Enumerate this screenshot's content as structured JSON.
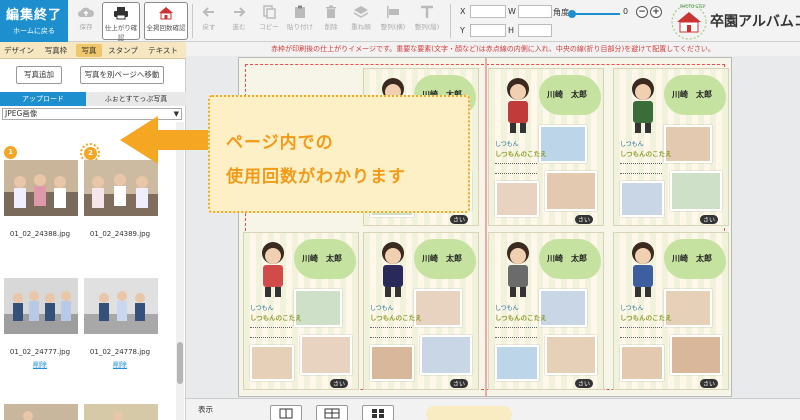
{
  "toolbar": {
    "finish_label": "編集終了",
    "finish_sub": "ホームに戻る",
    "save": "保存",
    "finish_check": "仕上がり確認",
    "usage_check": "全掲回数確認",
    "undo": "戻す",
    "redo": "進む",
    "copy": "コピー",
    "paste": "貼り付け",
    "delete": "削除",
    "layer": "重ね順",
    "align_h": "整列(横)",
    "align_v": "整列(縦)",
    "x_label": "X",
    "y_label": "Y",
    "w_label": "W",
    "h_label": "H",
    "angle_label": "角度",
    "angle_value": "0",
    "zoom_out": "−",
    "zoom_in": "+",
    "logo_text": "卒園アルバムコ",
    "logo_small": "PHOTO STEP"
  },
  "left": {
    "tabs": [
      "デザイン",
      "写真枠",
      "写真",
      "スタンプ",
      "テキスト"
    ],
    "active_tab": "写真",
    "add_photo": "写真追加",
    "move_page": "写真を別ページへ移動",
    "subtabs": [
      "アップロード",
      "ふぉとすてっぷ写真"
    ],
    "select_value": "JPEG画像",
    "photos": [
      {
        "name": "01_02_24388.jpg",
        "badge": "1",
        "delete": ""
      },
      {
        "name": "01_02_24389.jpg",
        "badge": "2",
        "delete": ""
      },
      {
        "name": "01_02_24777.jpg",
        "badge": "",
        "delete": "削除"
      },
      {
        "name": "01_02_24778.jpg",
        "badge": "",
        "delete": "削除"
      }
    ]
  },
  "workspace": {
    "notice": "赤枠が印刷後の仕上がりイメージです。重要な要素(文字・顔など)は赤点線の内側に入れ、中央の線(折り目部分)を避けて配置してください。",
    "cards": [
      {
        "name": "川崎　太郎",
        "label1": "しつもん",
        "label2": "しつもんのこたえ",
        "tag": "さい"
      },
      {
        "name": "川崎　太郎",
        "label1": "しつもん",
        "label2": "しつもんのこたえ",
        "tag": "さい"
      },
      {
        "name": "川崎　太郎",
        "label1": "しつもん",
        "label2": "しつもんのこたえ",
        "tag": "さい"
      },
      {
        "name": "川崎　太郎",
        "label1": "しつもん",
        "label2": "しつもんのこたえ",
        "tag": "さい"
      },
      {
        "name": "川崎　太郎",
        "label1": "しつもん",
        "label2": "しつもんのこたえ",
        "tag": "さい"
      },
      {
        "name": "川崎　太郎",
        "label1": "しつもん",
        "label2": "しつもんのこたえ",
        "tag": "さい"
      }
    ]
  },
  "callout": {
    "line1": "ページ内での",
    "line2": "使用回数がわかります"
  },
  "bottom": {
    "zoom_label": "表示"
  },
  "colors": {
    "brand_blue": "#1d8fcf",
    "accent_orange": "#f39a17",
    "guide_red": "#ef4b4b"
  }
}
